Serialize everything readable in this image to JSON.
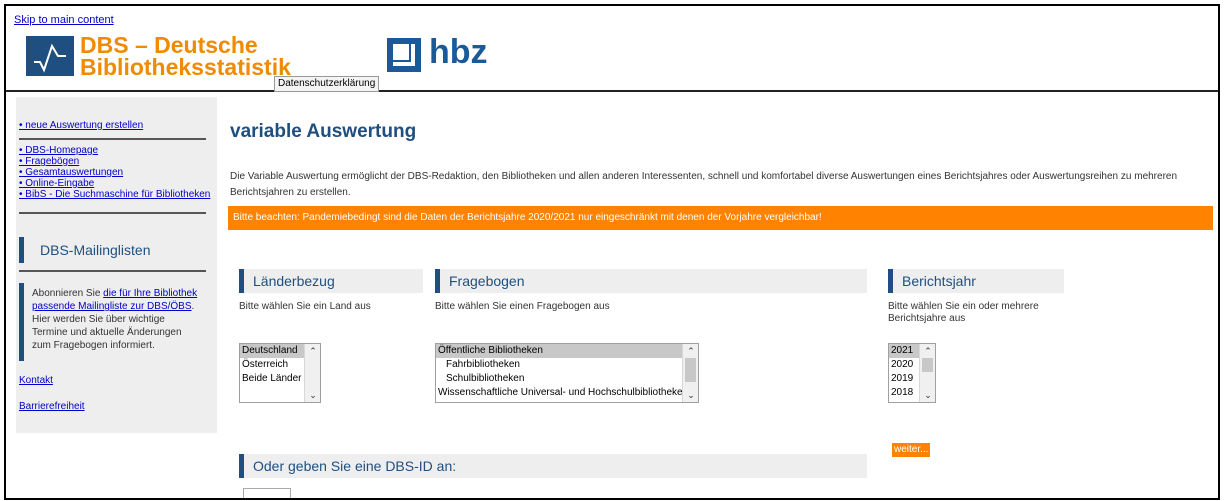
{
  "header": {
    "skip_link": "Skip to main content",
    "dbs_title_line1": "DBS – Deutsche",
    "dbs_title_line2": "Bibliotheksstatistik",
    "privacy_button": "Datenschutzerklärung",
    "hbz_text": "hbz"
  },
  "sidebar": {
    "new_report": "• neue Auswertung erstellen",
    "links": [
      "• DBS-Homepage",
      "• Fragebögen",
      "• Gesamtauswertungen",
      "• Online-Eingabe",
      "• BibS - Die Suchmaschine für Bibliotheken"
    ],
    "mailing_heading": "DBS-Mailinglisten",
    "mailing_text_before": "Abonnieren Sie ",
    "mailing_link": "die für Ihre Bibliothek passende Mailingliste zur DBS/ÖBS",
    "mailing_text_after": ". Hier werden Sie über wichtige Termine und aktuelle Änderungen zum Fragebogen informiert.",
    "contact": "Kontakt",
    "accessibility": "Barrierefreiheit"
  },
  "main": {
    "title": "variable Auswertung",
    "intro": "Die Variable Auswertung ermöglicht der DBS-Redaktion, den Bibliotheken und allen anderen Interessenten, schnell und komfortabel diverse Auswertungen eines Berichtsjahres oder Auswertungsreihen zu mehreren Berichtsjahren zu erstellen.",
    "notice": "Bitte beachten: Pandemiebedingt sind die Daten der Berichtsjahre 2020/2021 nur eingeschränkt mit denen der Vorjahre vergleichbar!",
    "countries": {
      "heading": "Länderbezug",
      "desc": "Bitte wählen Sie ein Land aus",
      "options": [
        "Deutschland",
        "Österreich",
        "Beide Länder"
      ],
      "selected": "Deutschland"
    },
    "questionnaire": {
      "heading": "Fragebogen",
      "desc": "Bitte wählen Sie einen Fragebogen aus",
      "options": [
        "Öffentliche Bibliotheken",
        "Fahrbibliotheken",
        "Schulbibliotheken",
        "Wissenschaftliche Universal- und Hochschulbibliotheken"
      ],
      "selected": "Öffentliche Bibliotheken"
    },
    "year": {
      "heading": "Berichtsjahr",
      "desc": "Bitte wählen Sie ein oder mehrere Berichtsjahre aus",
      "options": [
        "2021",
        "2020",
        "2019",
        "2018"
      ],
      "selected": "2021"
    },
    "next_button": "weiter...",
    "dbs_id_heading": "Oder geben Sie eine DBS-ID an:",
    "dbs_id_value": ""
  },
  "colors": {
    "accent_orange": "#ff8200",
    "brand_blue": "#1f4f80",
    "link_blue": "#0000cc"
  }
}
